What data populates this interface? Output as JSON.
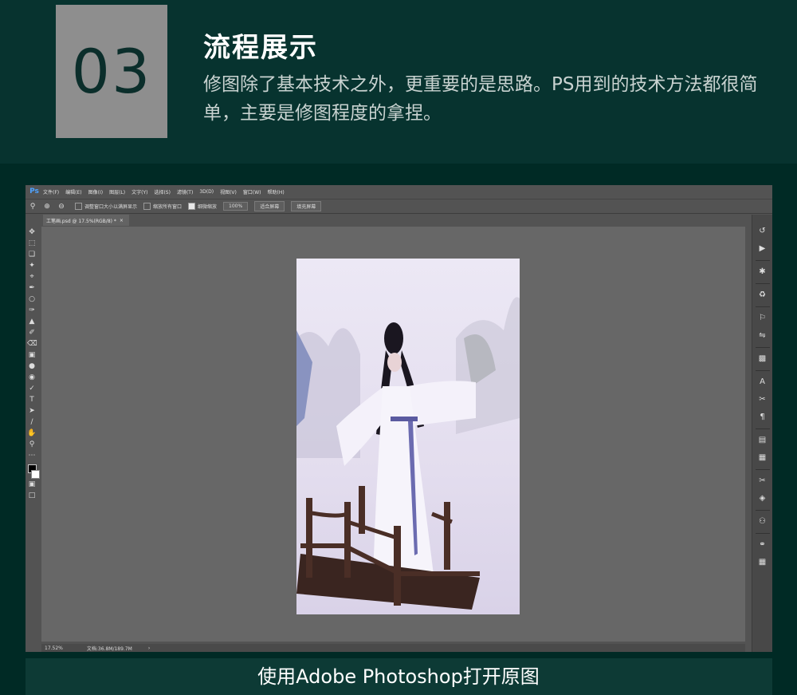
{
  "header": {
    "step_number": "03",
    "title": "流程展示",
    "subtitle": "修图除了基本技术之外，更重要的是思路。PS用到的技术方法都很简单，主要是修图程度的拿捏。"
  },
  "photoshop": {
    "logo": "Ps",
    "menu": [
      "文件(F)",
      "编辑(E)",
      "图像(I)",
      "图层(L)",
      "文字(Y)",
      "选择(S)",
      "滤镜(T)",
      "3D(D)",
      "视图(V)",
      "窗口(W)",
      "帮助(H)"
    ],
    "options": {
      "resize_windows": "调整窗口大小以满屏显示",
      "zoom_all": "缩放所有窗口",
      "scrubby_zoom": "细微缩放",
      "zoom_value": "100%",
      "fit_screen": "适合屏幕",
      "fill_screen": "填充屏幕"
    },
    "document_tab": "工笔画.psd @ 17.5%(RGB/8) *",
    "status": {
      "zoom": "17.52%",
      "doc_size": "文档:36.8M/189.7M"
    }
  },
  "caption": "使用Adobe Photoshop打开原图"
}
